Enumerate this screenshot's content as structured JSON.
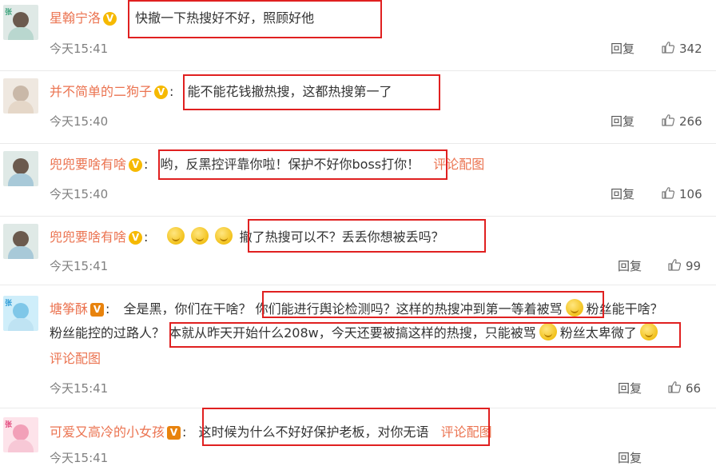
{
  "comments": [
    {
      "user": "星翰宁洛",
      "badge": "V",
      "text": "快撤一下热搜好不好，照顾好他",
      "time": "今天15:41",
      "reply": "回复",
      "likes": "342"
    },
    {
      "user": "并不简单的二狗子",
      "badge": "V",
      "text": "能不能花钱撤热搜，这都热搜第一了",
      "time": "今天15:40",
      "reply": "回复",
      "likes": "266"
    },
    {
      "user": "兜兜要啥有啥",
      "badge": "V",
      "text": "哟，反黑控评靠你啦！保护不好你boss打你！",
      "link": "评论配图",
      "time": "今天15:40",
      "reply": "回复",
      "likes": "106"
    },
    {
      "user": "兜兜要啥有啥",
      "badge": "V",
      "text": "撤了热搜可以不？丢丢你想被丢吗？",
      "time": "今天15:41",
      "reply": "回复",
      "likes": "99"
    },
    {
      "user": "塘筝酥",
      "badge": "V",
      "text_a": "全是黑，你们在干啥？",
      "text_b": "你们能进行舆论检测吗？这样的热搜冲到第一等着被骂",
      "text_c": "粉丝能干啥？",
      "text_d": "粉丝能控的过路人？",
      "text_e": "本就从昨天开始什么208w，今天还要被搞这样的热搜，只能被骂",
      "text_f": "粉丝太卑微了",
      "link": "评论配图",
      "time": "今天15:41",
      "reply": "回复",
      "likes": "66"
    },
    {
      "user": "可爱又高冷的小女孩",
      "badge": "V",
      "text": "这时候为什么不好好保护老板，对你无语",
      "link": "评论配图",
      "time": "今天15:41",
      "reply": "回复"
    }
  ],
  "icons": {
    "like": "thumb-up-icon",
    "emoji": "smile-emoji-icon",
    "verified": "verified-badge-icon"
  },
  "colors": {
    "username": "#eb7350",
    "highlight_box": "#e02020",
    "badge": "#f6b900"
  }
}
